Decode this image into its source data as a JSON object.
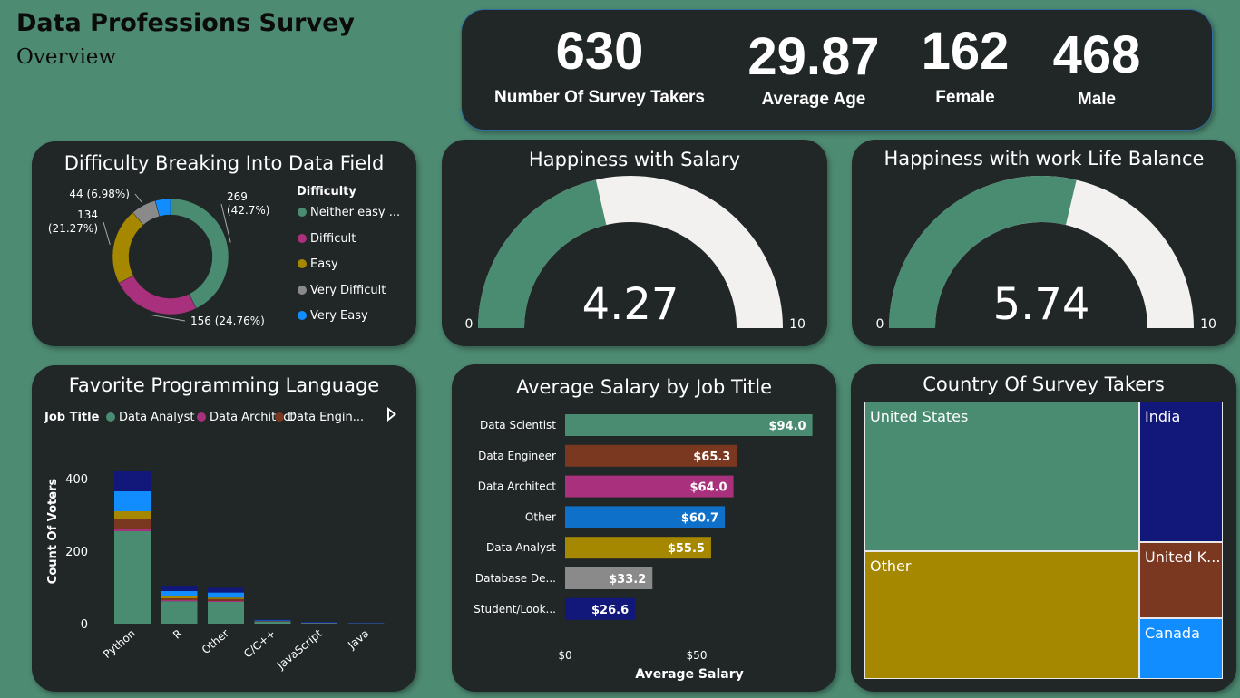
{
  "header": {
    "title": "Data Professions Survey",
    "subtitle": "Overview"
  },
  "kpis": [
    {
      "value": "630",
      "label": "Number Of Survey Takers"
    },
    {
      "value": "29.87",
      "label": "Average Age"
    },
    {
      "value": "162",
      "label": "Female"
    },
    {
      "value": "468",
      "label": "Male"
    }
  ],
  "colors": {
    "background": "#4e8b73",
    "card": "#212727",
    "green": "#4a8c72",
    "magenta": "#a9307d",
    "olive": "#a58700",
    "gray": "#8a8a8a",
    "lightblue": "#118dff",
    "brown": "#7b3820",
    "blue": "#0e70c8",
    "navy": "#12177a",
    "gauge_empty": "#f3f1f0"
  },
  "chart_data": [
    {
      "type": "pie",
      "title": "Difficulty Breaking Into Data Field",
      "legend_title": "Difficulty",
      "legend_placement": "right",
      "slices": [
        {
          "name": "Neither easy ...",
          "value": 269,
          "label": "269\n(42.7%)",
          "color": "#4a8c72"
        },
        {
          "name": "Difficult",
          "value": 156,
          "label": "156 (24.76%)",
          "color": "#a9307d"
        },
        {
          "name": "Easy",
          "value": 134,
          "label": "134\n(21.27%)",
          "color": "#a58700"
        },
        {
          "name": "Very Difficult",
          "value": 44,
          "label": "44 (6.98%)",
          "color": "#8a8a8a"
        },
        {
          "name": "Very Easy",
          "value": 27,
          "label": "",
          "color": "#118dff"
        }
      ]
    },
    {
      "type": "gauge",
      "title": "Happiness with Salary",
      "value": 4.27,
      "value_label": "4.27",
      "min": 0,
      "max": 10,
      "min_label": "0",
      "max_label": "10"
    },
    {
      "type": "gauge",
      "title": "Happiness with work Life Balance",
      "value": 5.74,
      "value_label": "5.74",
      "min": 0,
      "max": 10,
      "min_label": "0",
      "max_label": "10"
    },
    {
      "type": "bar",
      "stacked": true,
      "title": "Favorite Programming Language",
      "legend_title": "Job Title",
      "legend_entries": [
        {
          "name": "Data Analyst",
          "color": "#4a8c72"
        },
        {
          "name": "Data Architect",
          "color": "#a9307d"
        },
        {
          "name": "Data Engin...",
          "color": "#7b3820"
        }
      ],
      "ylabel": "Count Of Voters",
      "ylim": [
        0,
        430
      ],
      "yticks": [
        "0",
        "200",
        "400"
      ],
      "categories": [
        "Python",
        "R",
        "Other",
        "C/C++",
        "JavaScript",
        "Java"
      ],
      "series": [
        {
          "color": "#4a8c72",
          "values": [
            255,
            62,
            60,
            5,
            2,
            2
          ]
        },
        {
          "color": "#a9307d",
          "values": [
            5,
            3,
            3,
            0,
            0,
            0
          ]
        },
        {
          "color": "#7b3820",
          "values": [
            30,
            5,
            5,
            2,
            1,
            0
          ]
        },
        {
          "color": "#a58700",
          "values": [
            20,
            5,
            4,
            0,
            0,
            0
          ]
        },
        {
          "color": "#118dff",
          "values": [
            55,
            15,
            14,
            2,
            1,
            0
          ]
        },
        {
          "color": "#12177a",
          "values": [
            55,
            15,
            13,
            2,
            1,
            1
          ]
        }
      ]
    },
    {
      "type": "bar",
      "orientation": "horizontal",
      "title": "Average Salary by Job Title",
      "xlabel": "Average Salary",
      "xlim": [
        0,
        100
      ],
      "xticks": [
        "$0",
        "$50"
      ],
      "categories": [
        "Data Scientist",
        "Data Engineer",
        "Data Architect",
        "Other",
        "Data Analyst",
        "Database De...",
        "Student/Look..."
      ],
      "values": [
        94.0,
        65.3,
        64.0,
        60.7,
        55.5,
        33.2,
        26.6
      ],
      "labels": [
        "$94.0",
        "$65.3",
        "$64.0",
        "$60.7",
        "$55.5",
        "$33.2",
        "$26.6"
      ],
      "colors": [
        "#4a8c72",
        "#7b3820",
        "#a9307d",
        "#0e70c8",
        "#a58700",
        "#8a8a8a",
        "#12177a"
      ]
    },
    {
      "type": "treemap",
      "title": "Country Of Survey Takers",
      "items": [
        {
          "name": "United States",
          "color": "#4a8c72"
        },
        {
          "name": "Other",
          "color": "#a58700"
        },
        {
          "name": "India",
          "color": "#12177a"
        },
        {
          "name": "United K...",
          "color": "#7b3820"
        },
        {
          "name": "Canada",
          "color": "#118dff"
        }
      ]
    }
  ]
}
